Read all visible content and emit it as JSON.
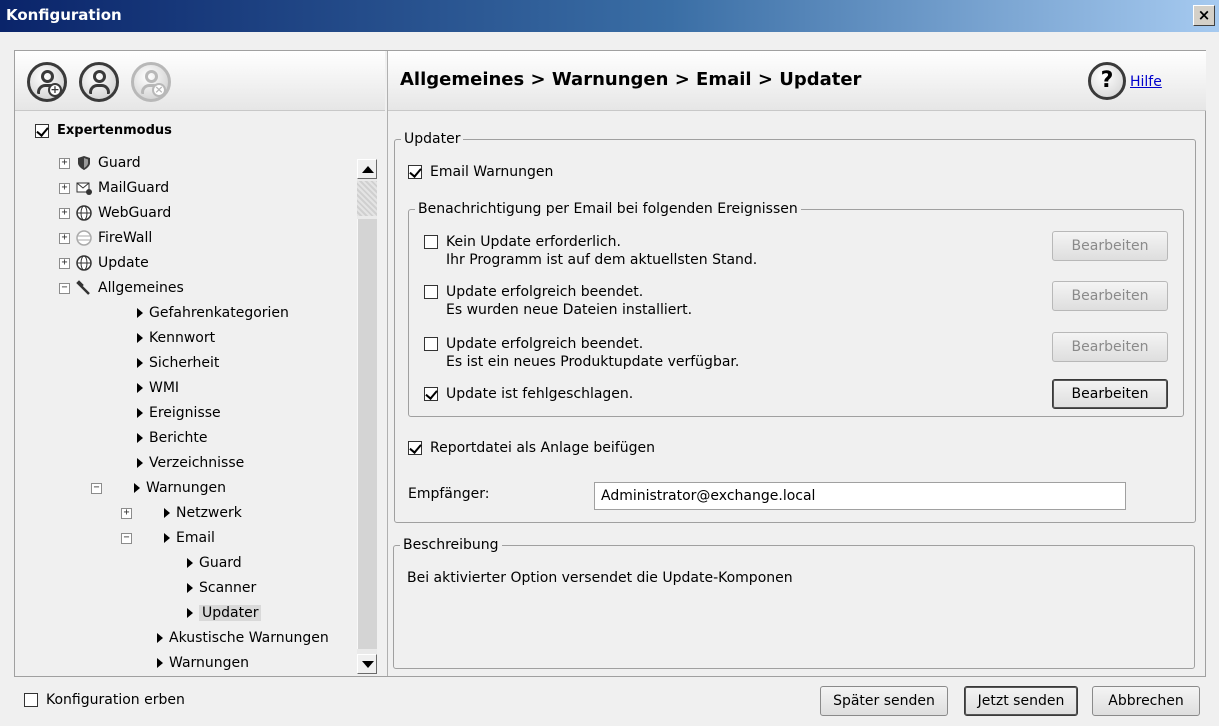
{
  "window": {
    "title": "Konfiguration",
    "close_label": "×"
  },
  "left": {
    "expert_mode": {
      "label": "Expertenmodus",
      "checked": true
    },
    "tree": [
      {
        "label": "Guard",
        "icon": "shield-icon",
        "expander": "+"
      },
      {
        "label": "MailGuard",
        "icon": "mail-icon",
        "expander": "+"
      },
      {
        "label": "WebGuard",
        "icon": "globe-icon",
        "expander": "+"
      },
      {
        "label": "FireWall",
        "icon": "firewall-icon",
        "expander": "+"
      },
      {
        "label": "Update",
        "icon": "update-globe-icon",
        "expander": "+"
      },
      {
        "label": "Allgemeines",
        "icon": "wrench-icon",
        "expander": "−"
      },
      {
        "label": "Gefahrenkategorien"
      },
      {
        "label": "Kennwort"
      },
      {
        "label": "Sicherheit"
      },
      {
        "label": "WMI"
      },
      {
        "label": "Ereignisse"
      },
      {
        "label": "Berichte"
      },
      {
        "label": "Verzeichnisse"
      },
      {
        "label": "Warnungen",
        "expander": "−"
      },
      {
        "label": "Netzwerk",
        "expander": "+"
      },
      {
        "label": "Email",
        "expander": "−"
      },
      {
        "label": "Guard"
      },
      {
        "label": "Scanner"
      },
      {
        "label": "Updater",
        "selected": true
      },
      {
        "label": "Akustische Warnungen"
      },
      {
        "label": "Warnungen"
      }
    ]
  },
  "right": {
    "breadcrumb": "Allgemeines > Warnungen > Email > Updater",
    "help_label": "Hilfe",
    "help_icon_glyph": "?",
    "updater_group": {
      "legend": "Updater",
      "email_warnings": {
        "label": "Email Warnungen",
        "checked": true
      },
      "notify_group": {
        "legend": "Benachrichtigung per Email bei folgenden Ereignissen",
        "items": [
          {
            "line1": "Kein Update erforderlich.",
            "line2": "Ihr Programm ist auf dem aktuellsten Stand.",
            "checked": false,
            "button": "Bearbeiten",
            "button_enabled": false
          },
          {
            "line1": "Update erfolgreich beendet.",
            "line2": "Es wurden neue Dateien installiert.",
            "checked": false,
            "button": "Bearbeiten",
            "button_enabled": false
          },
          {
            "line1": "Update erfolgreich beendet.",
            "line2": "Es ist ein neues Produktupdate verfügbar.",
            "checked": false,
            "button": "Bearbeiten",
            "button_enabled": false
          },
          {
            "line1": "Update ist fehlgeschlagen.",
            "line2": "",
            "checked": true,
            "button": "Bearbeiten",
            "button_enabled": true
          }
        ]
      },
      "attach_report": {
        "label": "Reportdatei als Anlage beifügen",
        "checked": true
      },
      "recipient": {
        "label": "Empfänger:",
        "value": "Administrator@exchange.local"
      }
    },
    "description_group": {
      "legend": "Beschreibung",
      "text": "Bei aktivierter Option versendet die Update-Komponen"
    }
  },
  "footer": {
    "inherit": {
      "label": "Konfiguration erben",
      "checked": false
    },
    "buttons": {
      "later": "Später senden",
      "now": "Jetzt senden",
      "cancel": "Abbrechen"
    }
  }
}
